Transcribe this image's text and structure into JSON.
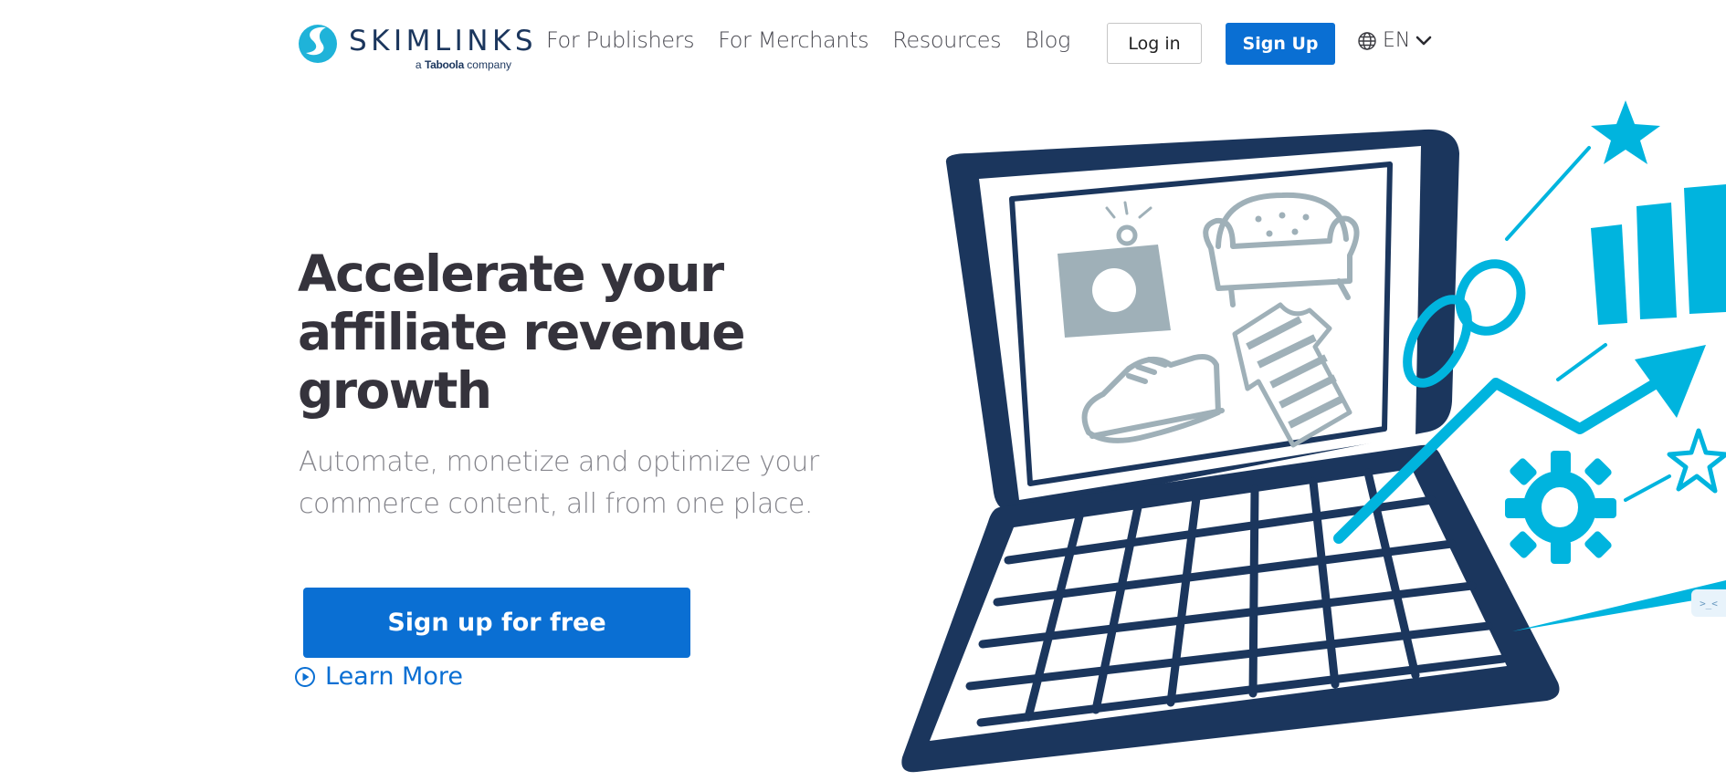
{
  "brand": {
    "name": "SKIMLINKS",
    "tagline_prefix": "a",
    "tagline_brand": "Taboola",
    "tagline_suffix": "company",
    "colors": {
      "navy": "#1b365d",
      "teal": "#1fb3d9",
      "primary_blue": "#0a6fd3",
      "illustration_cyan": "#00b4de",
      "illustration_gray": "#9fb0b8"
    }
  },
  "nav": {
    "items": [
      {
        "label": "For Publishers"
      },
      {
        "label": "For Merchants"
      },
      {
        "label": "Resources"
      },
      {
        "label": "Blog"
      }
    ],
    "login_label": "Log in",
    "signup_label": "Sign Up",
    "language": {
      "icon": "globe-icon",
      "code": "EN",
      "chevron": "chevron-down-icon"
    }
  },
  "hero": {
    "title_lines": [
      "Accelerate your",
      "affiliate revenue",
      "growth"
    ],
    "subtitle_lines": [
      "Automate, monetize and optimize your",
      "commerce content, all from one place."
    ],
    "cta_label": "Sign up for free",
    "learn_more_label": "Learn More",
    "learn_more_icon": "play-circle-icon"
  },
  "illustration": {
    "subject": "laptop with product icons and growth graphics",
    "screen_items": [
      "camera-icon",
      "sofa-icon",
      "sneaker-icon",
      "tshirt-icon"
    ],
    "decor_items": [
      "star-icon",
      "bar-chart-icon",
      "chain-link-icon",
      "trend-arrow-icon",
      "gear-icon",
      "outline-star-icon"
    ]
  },
  "corner_widget": {
    "label": ">_<"
  }
}
